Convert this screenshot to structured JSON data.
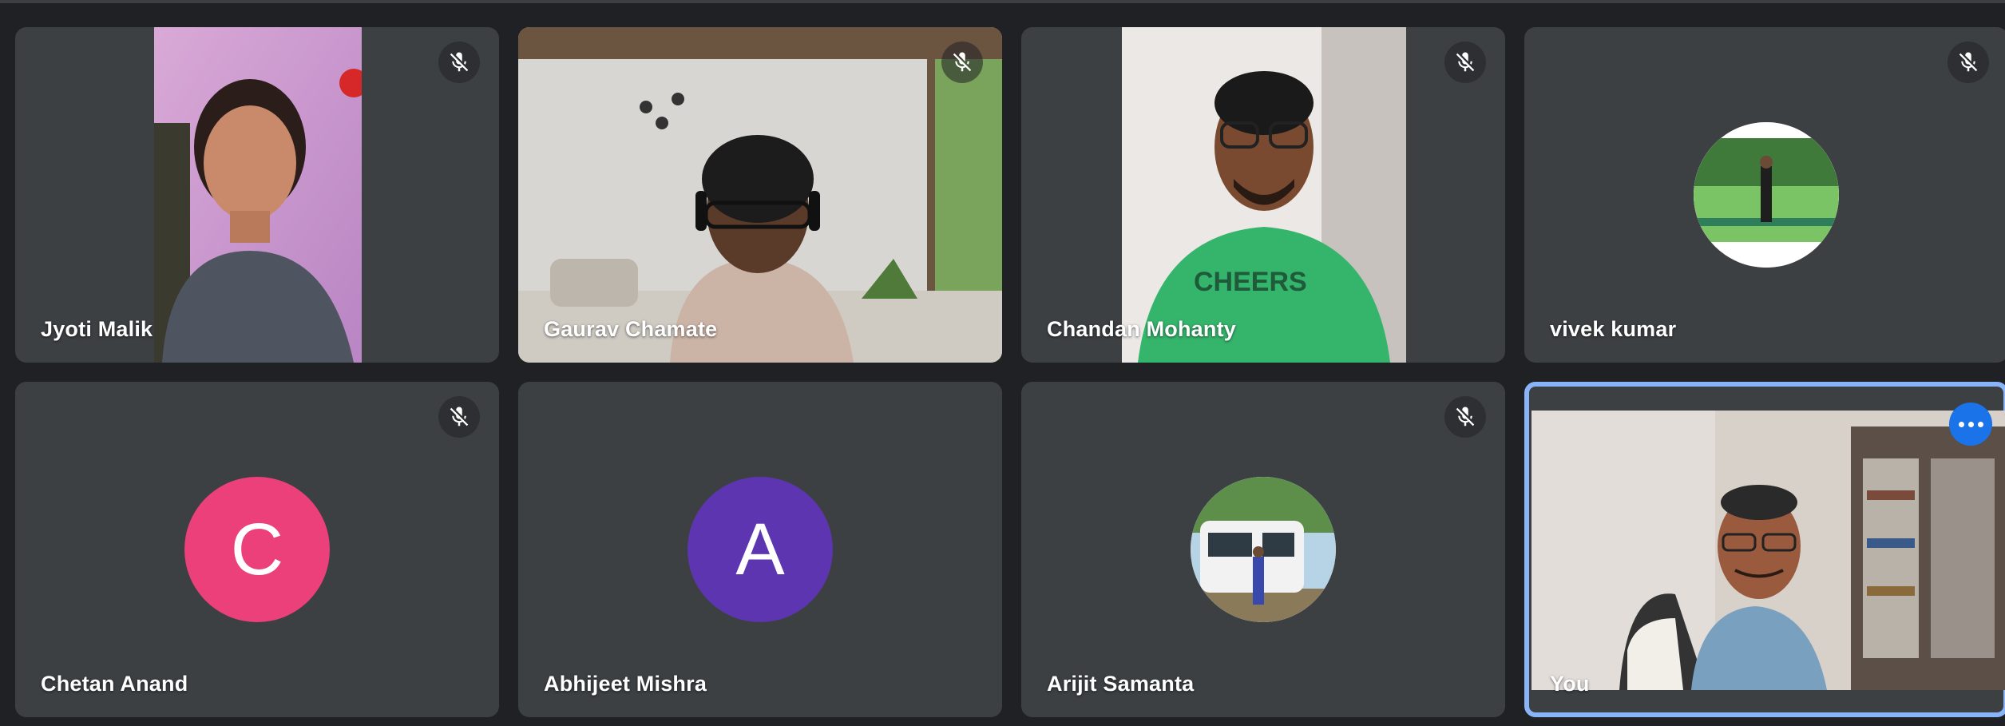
{
  "participants": [
    {
      "name": "Jyoti Malik",
      "muted": true,
      "type": "video"
    },
    {
      "name": "Gaurav Chamate",
      "muted": true,
      "type": "video"
    },
    {
      "name": "Chandan Mohanty",
      "muted": true,
      "type": "video"
    },
    {
      "name": "vivek kumar",
      "muted": true,
      "type": "avatar-photo"
    },
    {
      "name": "Chetan Anand",
      "muted": true,
      "type": "avatar-letter",
      "initial": "C",
      "color": "#ec407a"
    },
    {
      "name": "Abhijeet Mishra",
      "muted": false,
      "type": "avatar-letter",
      "initial": "A",
      "color": "#5e35b1"
    },
    {
      "name": "Arijit Samanta",
      "muted": true,
      "type": "avatar-photo"
    },
    {
      "name": "You",
      "muted": false,
      "type": "video",
      "self": true
    }
  ],
  "icons": {
    "mute": "mic-off-icon",
    "more": "more-options-icon"
  },
  "colors": {
    "background": "#202124",
    "tile": "#3c4043",
    "active_outline": "#8ab4f8",
    "more_button": "#1a73e8"
  }
}
